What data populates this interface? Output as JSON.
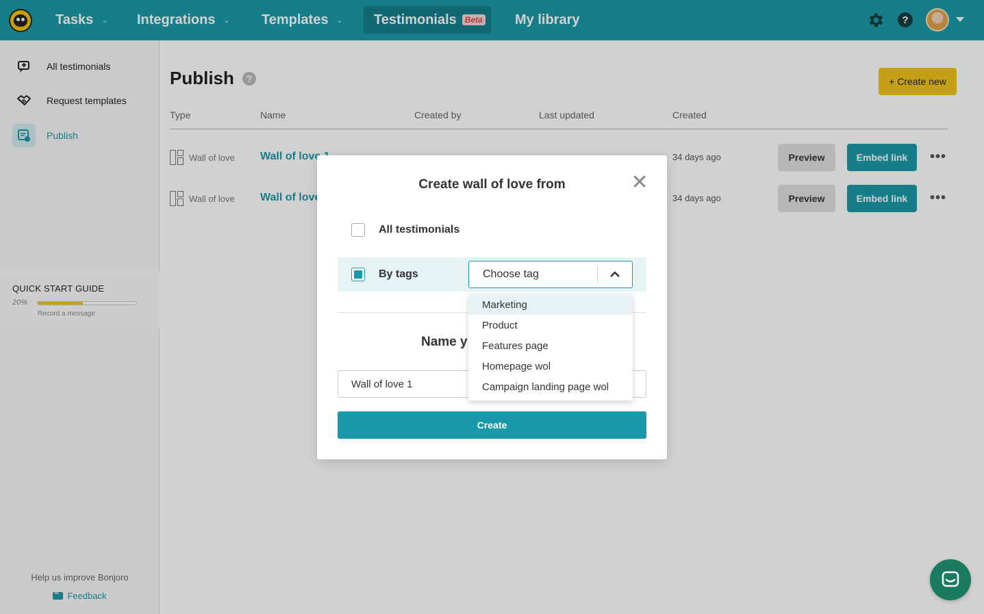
{
  "nav": {
    "items": [
      {
        "label": "Tasks",
        "has_chevron": true
      },
      {
        "label": "Integrations",
        "has_chevron": true
      },
      {
        "label": "Templates",
        "has_chevron": true
      },
      {
        "label": "Testimonials",
        "badge": "Beta",
        "active": true
      },
      {
        "label": "My library"
      }
    ],
    "help_glyph": "?"
  },
  "sidebar": {
    "items": [
      {
        "label": "All testimonials",
        "icon": "chat-bubble-icon"
      },
      {
        "label": "Request templates",
        "icon": "handshake-icon"
      },
      {
        "label": "Publish",
        "icon": "publish-icon",
        "active": true
      }
    ],
    "quick_start": {
      "title": "QUICK START GUIDE",
      "percent_label": "20%",
      "progress": 0.46,
      "subtitle": "Record a message"
    },
    "improve_text": "Help us improve Bonjoro",
    "feedback_label": "Feedback"
  },
  "main": {
    "title": "Publish",
    "help_glyph": "?",
    "create_new_label": "+ Create new",
    "columns": [
      "Type",
      "Name",
      "Created by",
      "Last updated",
      "Created"
    ],
    "rows": [
      {
        "type": "Wall of love",
        "name": "Wall of love 1",
        "created": "34 days ago",
        "preview": "Preview",
        "embed": "Embed link",
        "more": "•••"
      },
      {
        "type": "Wall of love",
        "name": "Wall of love",
        "created": "34 days ago",
        "preview": "Preview",
        "embed": "Embed link",
        "more": "•••"
      }
    ]
  },
  "modal": {
    "title": "Create wall of love from",
    "close_glyph": "✕",
    "options": [
      {
        "label": "All testimonials",
        "checked": false
      },
      {
        "label": "By tags",
        "checked": true
      }
    ],
    "tag_select": {
      "value": "Choose tag",
      "open": true
    },
    "name_heading": "Name y",
    "name_value": "Wall of love 1",
    "create_label": "Create"
  },
  "dropdown": {
    "options": [
      "Marketing",
      "Product",
      "Features page",
      "Homepage wol",
      "Campaign landing page wol"
    ],
    "highlighted_index": 0
  },
  "colors": {
    "brand_teal": "#1a9aa8",
    "accent_yellow": "#f0c419",
    "chat_green": "#1b7b5e"
  }
}
